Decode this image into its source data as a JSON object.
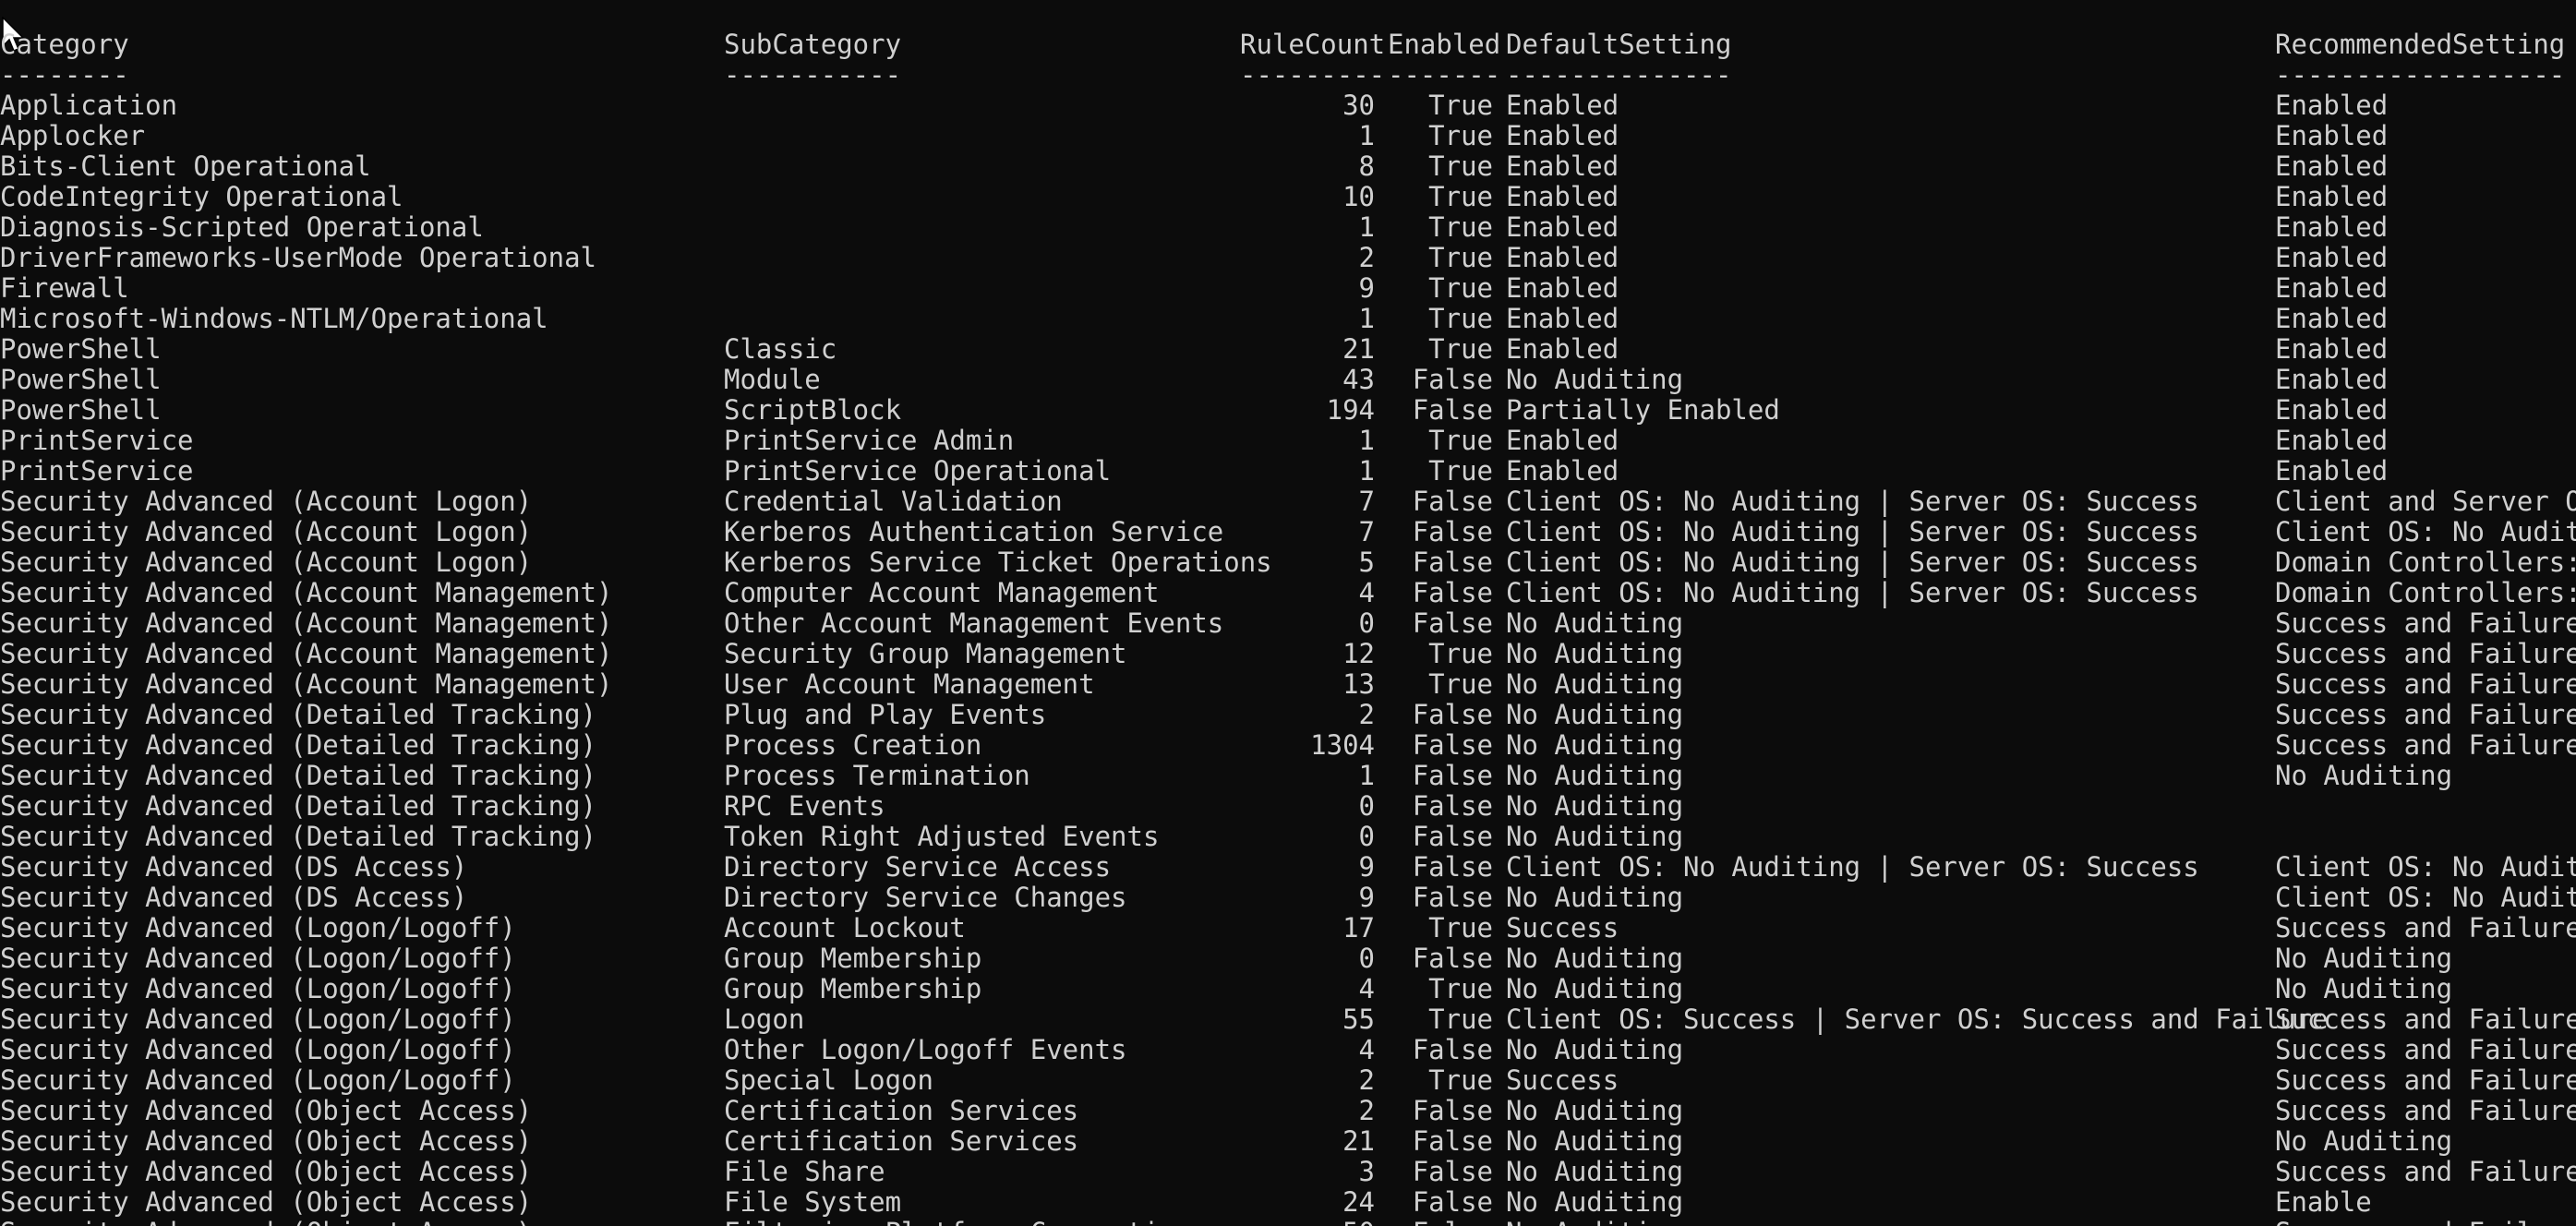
{
  "columns": {
    "category": "Category",
    "subcategory": "SubCategory",
    "rulecount": "RuleCount",
    "enabled": "Enabled",
    "default": "DefaultSetting",
    "recommended": "RecommendedSetting"
  },
  "separators": {
    "category": "--------",
    "subcategory": "-----------",
    "rulecount": "---------",
    "enabled": "-------",
    "default": "--------------",
    "recommended": "------------------"
  },
  "rows": [
    {
      "category": "Application",
      "subcategory": "",
      "rulecount": "30",
      "enabled": "True",
      "default": "Enabled",
      "recommended": "Enabled"
    },
    {
      "category": "Applocker",
      "subcategory": "",
      "rulecount": "1",
      "enabled": "True",
      "default": "Enabled",
      "recommended": "Enabled"
    },
    {
      "category": "Bits-Client Operational",
      "subcategory": "",
      "rulecount": "8",
      "enabled": "True",
      "default": "Enabled",
      "recommended": "Enabled"
    },
    {
      "category": "CodeIntegrity Operational",
      "subcategory": "",
      "rulecount": "10",
      "enabled": "True",
      "default": "Enabled",
      "recommended": "Enabled"
    },
    {
      "category": "Diagnosis-Scripted Operational",
      "subcategory": "",
      "rulecount": "1",
      "enabled": "True",
      "default": "Enabled",
      "recommended": "Enabled"
    },
    {
      "category": "DriverFrameworks-UserMode Operational",
      "subcategory": "",
      "rulecount": "2",
      "enabled": "True",
      "default": "Enabled",
      "recommended": "Enabled"
    },
    {
      "category": "Firewall",
      "subcategory": "",
      "rulecount": "9",
      "enabled": "True",
      "default": "Enabled",
      "recommended": "Enabled"
    },
    {
      "category": "Microsoft-Windows-NTLM/Operational",
      "subcategory": "",
      "rulecount": "1",
      "enabled": "True",
      "default": "Enabled",
      "recommended": "Enabled"
    },
    {
      "category": "PowerShell",
      "subcategory": "Classic",
      "rulecount": "21",
      "enabled": "True",
      "default": "Enabled",
      "recommended": "Enabled"
    },
    {
      "category": "PowerShell",
      "subcategory": "Module",
      "rulecount": "43",
      "enabled": "False",
      "default": "No Auditing",
      "recommended": "Enabled"
    },
    {
      "category": "PowerShell",
      "subcategory": "ScriptBlock",
      "rulecount": "194",
      "enabled": "False",
      "default": "Partially Enabled",
      "recommended": "Enabled"
    },
    {
      "category": "PrintService",
      "subcategory": "PrintService Admin",
      "rulecount": "1",
      "enabled": "True",
      "default": "Enabled",
      "recommended": "Enabled"
    },
    {
      "category": "PrintService",
      "subcategory": "PrintService Operational",
      "rulecount": "1",
      "enabled": "True",
      "default": "Enabled",
      "recommended": "Enabled"
    },
    {
      "category": "Security Advanced (Account Logon)",
      "subcategory": "Credential Validation",
      "rulecount": "7",
      "enabled": "False",
      "default": "Client OS: No Auditing | Server OS: Success",
      "recommended": "Client and Server OSe"
    },
    {
      "category": "Security Advanced (Account Logon)",
      "subcategory": "Kerberos Authentication Service",
      "rulecount": "7",
      "enabled": "False",
      "default": "Client OS: No Auditing | Server OS: Success",
      "recommended": "Client OS: No Auditin"
    },
    {
      "category": "Security Advanced (Account Logon)",
      "subcategory": "Kerberos Service Ticket Operations",
      "rulecount": "5",
      "enabled": "False",
      "default": "Client OS: No Auditing | Server OS: Success",
      "recommended": "Domain Controllers: S"
    },
    {
      "category": "Security Advanced (Account Management)",
      "subcategory": "Computer Account Management",
      "rulecount": "4",
      "enabled": "False",
      "default": "Client OS: No Auditing | Server OS: Success",
      "recommended": "Domain Controllers: S"
    },
    {
      "category": "Security Advanced (Account Management)",
      "subcategory": "Other Account Management Events",
      "rulecount": "0",
      "enabled": "False",
      "default": "No Auditing",
      "recommended": "Success and Failure"
    },
    {
      "category": "Security Advanced (Account Management)",
      "subcategory": "Security Group Management",
      "rulecount": "12",
      "enabled": "True",
      "default": "No Auditing",
      "recommended": "Success and Failure"
    },
    {
      "category": "Security Advanced (Account Management)",
      "subcategory": "User Account Management",
      "rulecount": "13",
      "enabled": "True",
      "default": "No Auditing",
      "recommended": "Success and Failure"
    },
    {
      "category": "Security Advanced (Detailed Tracking)",
      "subcategory": "Plug and Play Events",
      "rulecount": "2",
      "enabled": "False",
      "default": "No Auditing",
      "recommended": "Success and Failure"
    },
    {
      "category": "Security Advanced (Detailed Tracking)",
      "subcategory": "Process Creation",
      "rulecount": "1304",
      "enabled": "False",
      "default": "No Auditing",
      "recommended": "Success and Failure"
    },
    {
      "category": "Security Advanced (Detailed Tracking)",
      "subcategory": "Process Termination",
      "rulecount": "1",
      "enabled": "False",
      "default": "No Auditing",
      "recommended": "No Auditing"
    },
    {
      "category": "Security Advanced (Detailed Tracking)",
      "subcategory": "RPC Events",
      "rulecount": "0",
      "enabled": "False",
      "default": "No Auditing",
      "recommended": ""
    },
    {
      "category": "Security Advanced (Detailed Tracking)",
      "subcategory": "Token Right Adjusted Events",
      "rulecount": "0",
      "enabled": "False",
      "default": "No Auditing",
      "recommended": ""
    },
    {
      "category": "Security Advanced (DS Access)",
      "subcategory": "Directory Service Access",
      "rulecount": "9",
      "enabled": "False",
      "default": "Client OS: No Auditing | Server OS: Success",
      "recommended": "Client OS: No Auditin"
    },
    {
      "category": "Security Advanced (DS Access)",
      "subcategory": "Directory Service Changes",
      "rulecount": "9",
      "enabled": "False",
      "default": "No Auditing",
      "recommended": "Client OS: No Auditin"
    },
    {
      "category": "Security Advanced (Logon/Logoff)",
      "subcategory": "Account Lockout",
      "rulecount": "17",
      "enabled": "True",
      "default": "Success",
      "recommended": "Success and Failure"
    },
    {
      "category": "Security Advanced (Logon/Logoff)",
      "subcategory": "Group Membership",
      "rulecount": "0",
      "enabled": "False",
      "default": "No Auditing",
      "recommended": "No Auditing"
    },
    {
      "category": "Security Advanced (Logon/Logoff)",
      "subcategory": "Group Membership",
      "rulecount": "4",
      "enabled": "True",
      "default": "No Auditing",
      "recommended": "No Auditing"
    },
    {
      "category": "Security Advanced (Logon/Logoff)",
      "subcategory": "Logon",
      "rulecount": "55",
      "enabled": "True",
      "default": "Client OS: Success | Server OS: Success and Failure",
      "recommended": "Success and Failure"
    },
    {
      "category": "Security Advanced (Logon/Logoff)",
      "subcategory": "Other Logon/Logoff Events",
      "rulecount": "4",
      "enabled": "False",
      "default": "No Auditing",
      "recommended": "Success and Failure"
    },
    {
      "category": "Security Advanced (Logon/Logoff)",
      "subcategory": "Special Logon",
      "rulecount": "2",
      "enabled": "True",
      "default": "Success",
      "recommended": "Success and Failure"
    },
    {
      "category": "Security Advanced (Object Access)",
      "subcategory": "Certification Services",
      "rulecount": "2",
      "enabled": "False",
      "default": "No Auditing",
      "recommended": "Success and Failure f"
    },
    {
      "category": "Security Advanced (Object Access)",
      "subcategory": "Certification Services",
      "rulecount": "21",
      "enabled": "False",
      "default": "No Auditing",
      "recommended": "No Auditing"
    },
    {
      "category": "Security Advanced (Object Access)",
      "subcategory": "File Share",
      "rulecount": "3",
      "enabled": "False",
      "default": "No Auditing",
      "recommended": "Success and Failure"
    },
    {
      "category": "Security Advanced (Object Access)",
      "subcategory": "File System",
      "rulecount": "24",
      "enabled": "False",
      "default": "No Auditing",
      "recommended": "Enable"
    },
    {
      "category": "Security Advanced (Object Access)",
      "subcategory": "Filtering Platform Connection",
      "rulecount": "50",
      "enabled": "False",
      "default": "No Auditing",
      "recommended": "Success and Failure"
    }
  ]
}
